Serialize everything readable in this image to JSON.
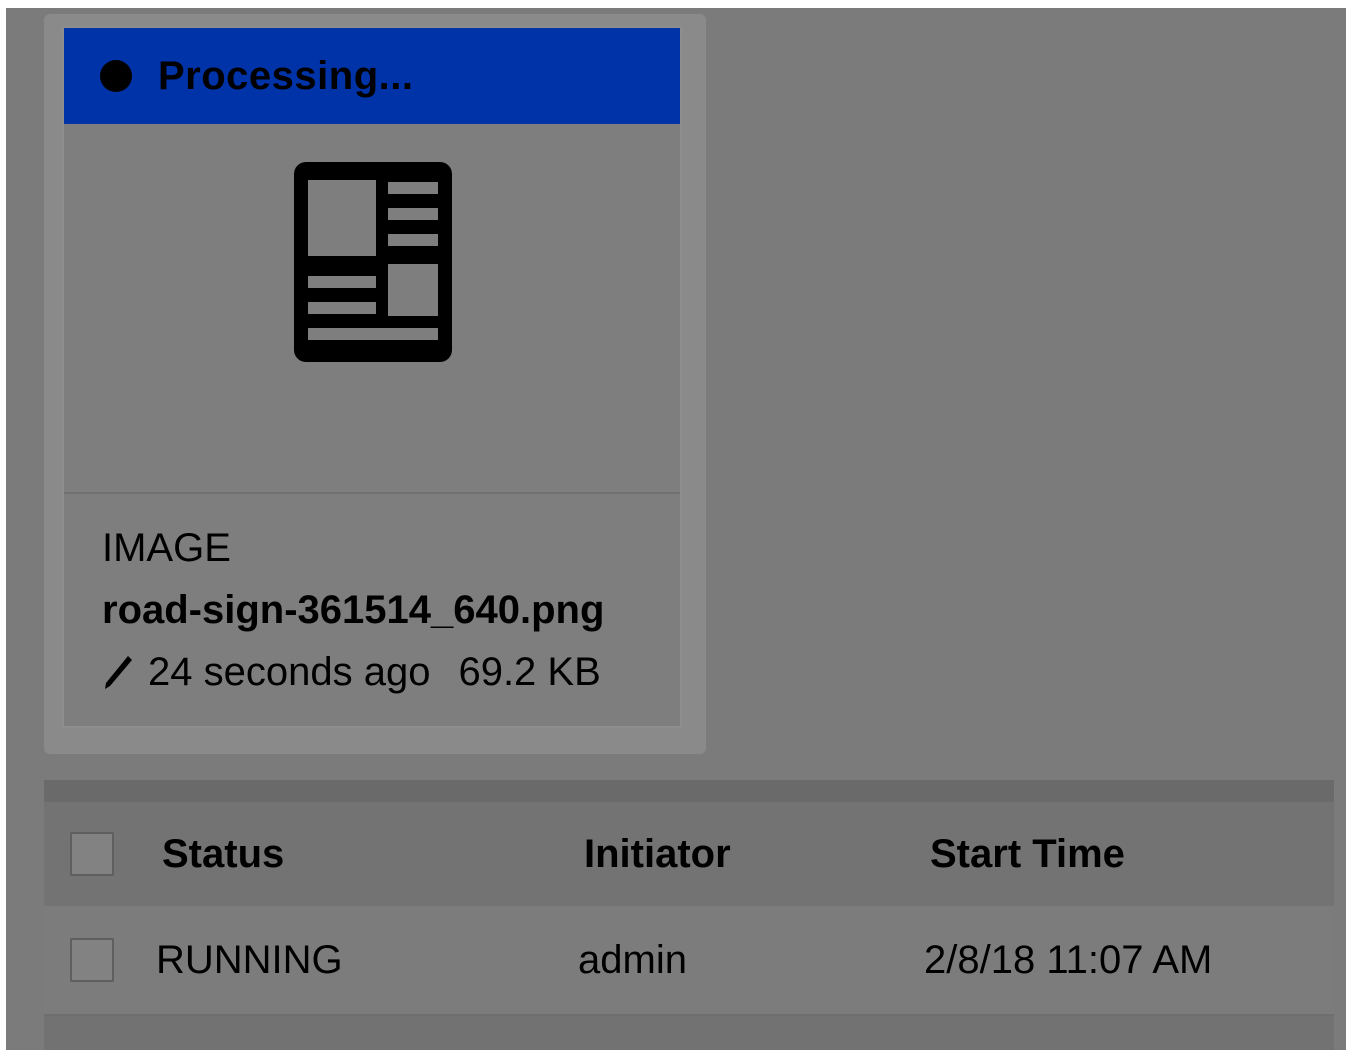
{
  "card": {
    "status_label": "Processing...",
    "status_color": "#0032a8",
    "preview_icon": "document-layout-icon",
    "file_type": "IMAGE",
    "file_name": "road-sign-361514_640.png",
    "modified_icon": "pencil-icon",
    "modified": "24 seconds ago",
    "size": "69.2 KB"
  },
  "table": {
    "columns": {
      "status": "Status",
      "initiator": "Initiator",
      "start_time": "Start Time"
    },
    "rows": [
      {
        "status": "RUNNING",
        "initiator": "admin",
        "start_time": "2/8/18 11:07 AM"
      }
    ]
  }
}
